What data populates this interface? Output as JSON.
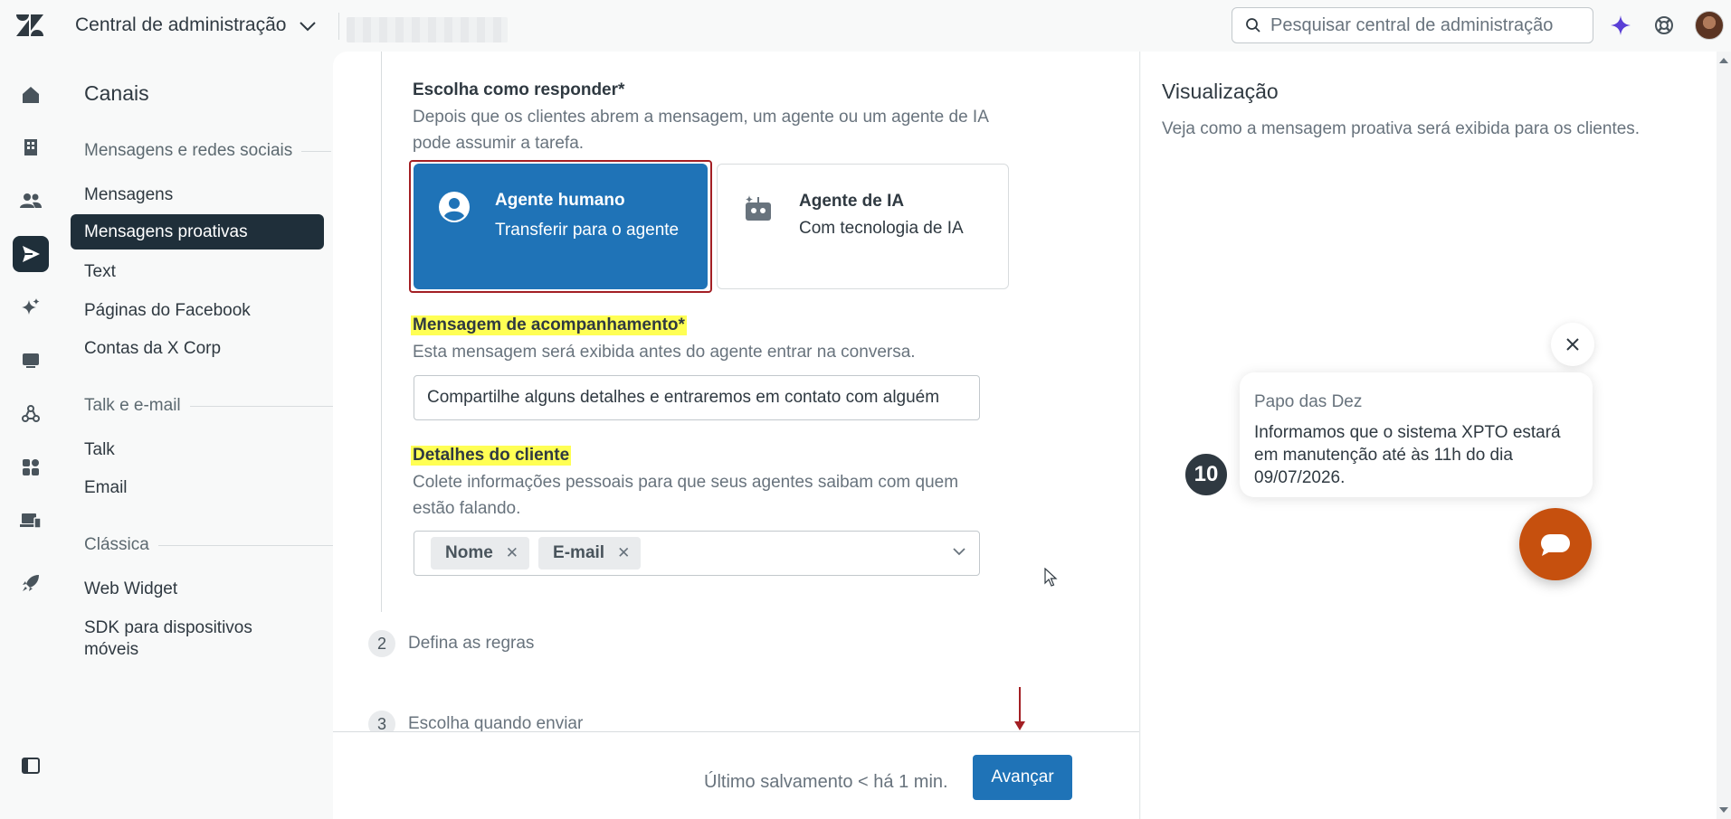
{
  "header": {
    "product_name": "Central de administração",
    "search_placeholder": "Pesquisar central de administração"
  },
  "sidebar": {
    "title": "Canais",
    "groups": [
      {
        "label": "Mensagens e redes sociais",
        "items": [
          "Mensagens",
          "Mensagens proativas",
          "Text",
          "Páginas do Facebook",
          "Contas da X Corp"
        ]
      },
      {
        "label": "Talk e e-mail",
        "items": [
          "Talk",
          "Email"
        ]
      },
      {
        "label": "Clássica",
        "items": [
          "Web Widget",
          "SDK para dispositivos móveis"
        ]
      }
    ],
    "active_item": "Mensagens proativas"
  },
  "form": {
    "respond_label": "Escolha como responder*",
    "respond_hint": "Depois que os clientes abrem a mensagem, um agente ou um agente de IA pode assumir a tarefa.",
    "options": [
      {
        "title": "Agente humano",
        "subtitle": "Transferir para o agente",
        "selected": true
      },
      {
        "title": "Agente de IA",
        "subtitle": "Com tecnologia de IA",
        "selected": false
      }
    ],
    "followup_label": "Mensagem de acompanhamento*",
    "followup_hint": "Esta mensagem será exibida antes do agente entrar na conversa.",
    "followup_value": "Compartilhe alguns detalhes e entraremos em contato com alguém",
    "customer_label": "Detalhes do cliente",
    "customer_hint": "Colete informações pessoais para que seus agentes saibam com quem estão falando.",
    "customer_tags": [
      "Nome",
      "E-mail"
    ],
    "steps": [
      {
        "num": "2",
        "label": "Defina as regras"
      },
      {
        "num": "3",
        "label": "Escolha quando enviar"
      }
    ],
    "last_saved": "Último salvamento < há 1 min.",
    "next_button": "Avançar"
  },
  "preview": {
    "title": "Visualização",
    "hint": "Veja como a mensagem proativa será exibida para os clientes.",
    "sender": "Papo das Dez",
    "message": "Informamos que o sistema XPTO estará em manutenção até às 11h do dia 09/07/2026.",
    "avatar_text": "10",
    "launcher_color": "#c6500e"
  },
  "colors": {
    "primary": "#1f73b7",
    "highlight": "#ffff54",
    "selected_outline": "#a31f24",
    "sidebar_active": "#1f2f3a"
  }
}
